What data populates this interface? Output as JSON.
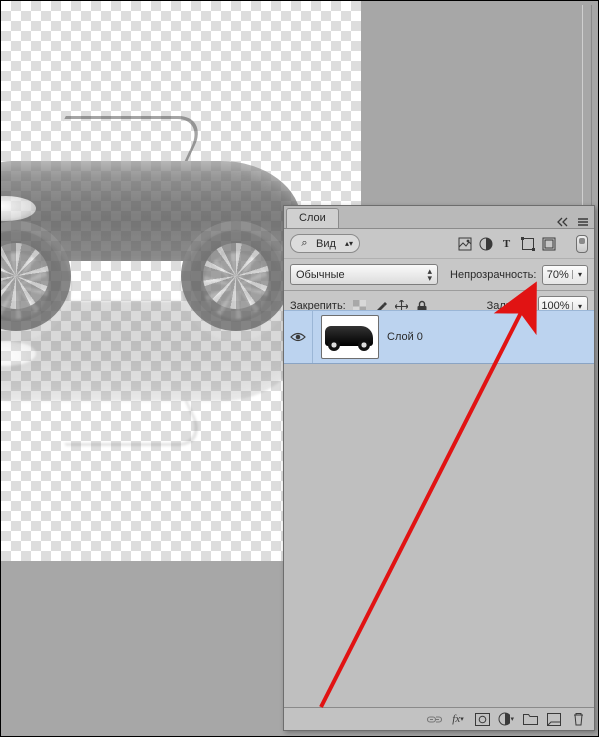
{
  "panel": {
    "tab_label": "Слои",
    "filter_label": "Вид",
    "blend_mode": "Обычные",
    "opacity_label": "Непрозрачность:",
    "opacity_value": "70%",
    "lock_label": "Закрепить:",
    "fill_label": "Заливка:",
    "fill_value": "100%"
  },
  "layers": [
    {
      "name": "Слой 0",
      "visible": true
    }
  ],
  "icons": {
    "search": "⌕",
    "triangle_down": "▾",
    "updown": "▴▾",
    "image_filter": "image-filter-icon",
    "adjust_filter": "adjust-filter-icon",
    "type_filter": "T",
    "shape_filter": "shape-filter-icon",
    "smart_filter": "smart-filter-icon",
    "lock_pixels": "▦",
    "lock_brush": "✎",
    "lock_move": "✥",
    "lock_all": "🔒",
    "eye": "👁",
    "link": "⧉",
    "fx": "fx",
    "mask": "mask",
    "adjust": "◑",
    "group": "🗀",
    "new": "new",
    "trash": "🗑",
    "menu": "≡",
    "collapse": "◂◂"
  },
  "annotation": {
    "color": "#e11313"
  }
}
